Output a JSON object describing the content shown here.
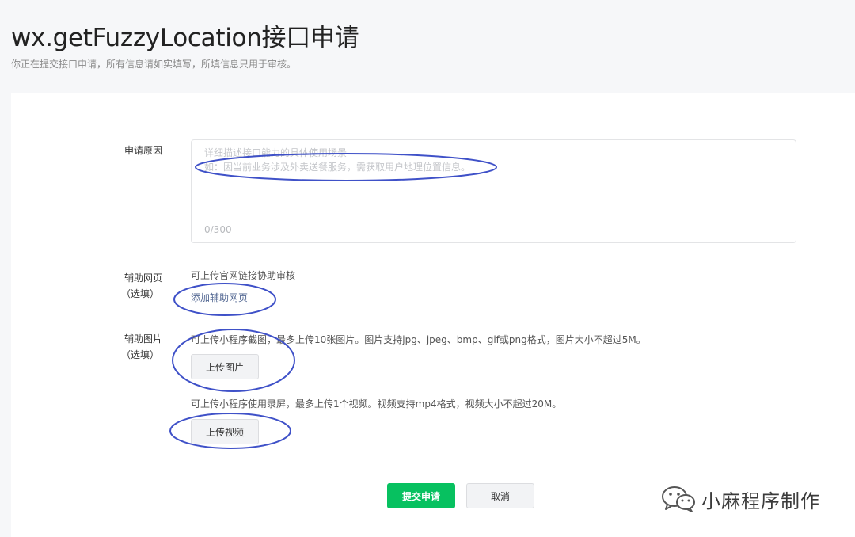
{
  "header": {
    "title": "wx.getFuzzyLocation接口申请",
    "subtitle": "你正在提交接口申请，所有信息请如实填写，所填信息只用于审核。"
  },
  "form": {
    "reason": {
      "label": "申请原因",
      "placeholder_line1": "详细描述接口能力的具体使用场景",
      "placeholder_line2": "如：因当前业务涉及外卖送餐服务，需获取用户地理位置信息。",
      "counter": "0/300"
    },
    "webpage": {
      "label_line1": "辅助网页",
      "label_line2": "（选填）",
      "hint": "可上传官网链接协助审核",
      "link": "添加辅助网页"
    },
    "images": {
      "label_line1": "辅助图片",
      "label_line2": "（选填）",
      "hint": "可上传小程序截图，最多上传10张图片。图片支持jpg、jpeg、bmp、gif或png格式，图片大小不超过5M。",
      "button": "上传图片"
    },
    "video": {
      "hint": "可上传小程序使用录屏，最多上传1个视频。视频支持mp4格式，视频大小不超过20M。",
      "button": "上传视频"
    }
  },
  "actions": {
    "submit": "提交申请",
    "cancel": "取消"
  },
  "watermark": {
    "text": "小麻程序制作",
    "icon": "wechat-icon"
  },
  "colors": {
    "primary": "#07c160",
    "link": "#576b95",
    "annotation": "#3f51c8"
  }
}
